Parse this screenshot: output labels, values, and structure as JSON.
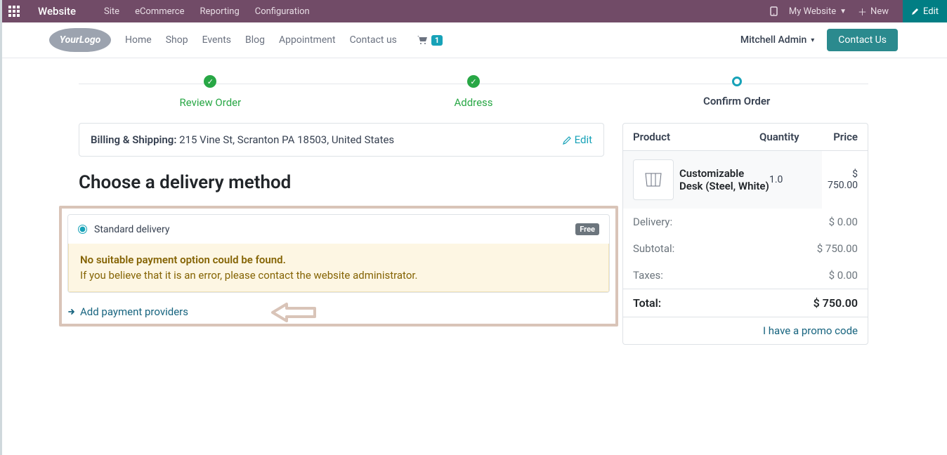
{
  "topbar": {
    "title": "Website",
    "menu": [
      "Site",
      "eCommerce",
      "Reporting",
      "Configuration"
    ],
    "website_selector": "My Website",
    "new_btn": "New",
    "edit_btn": "Edit"
  },
  "header": {
    "logo_text": "YourLogo",
    "nav": [
      "Home",
      "Shop",
      "Events",
      "Blog",
      "Appointment",
      "Contact us"
    ],
    "cart_count": "1",
    "user_name": "Mitchell Admin",
    "contact_btn": "Contact Us"
  },
  "stepper": {
    "steps": [
      {
        "label": "Review Order",
        "state": "done"
      },
      {
        "label": "Address",
        "state": "done"
      },
      {
        "label": "Confirm Order",
        "state": "current"
      }
    ]
  },
  "billing": {
    "label": "Billing & Shipping:",
    "address": "215 Vine St, Scranton PA 18503, United States",
    "edit_label": "Edit"
  },
  "delivery": {
    "heading": "Choose a delivery method",
    "option_label": "Standard delivery",
    "free_badge": "Free",
    "warning_title": "No suitable payment option could be found.",
    "warning_text": "If you believe that it is an error, please contact the website administrator.",
    "add_providers": "Add payment providers"
  },
  "summary": {
    "cols": {
      "product": "Product",
      "qty": "Quantity",
      "price": "Price"
    },
    "item": {
      "name": "Customizable Desk (Steel, White)",
      "qty": "1.0",
      "price": "$ 750.00"
    },
    "rows": [
      {
        "label": "Delivery:",
        "value": "$ 0.00"
      },
      {
        "label": "Subtotal:",
        "value": "$ 750.00"
      },
      {
        "label": "Taxes:",
        "value": "$ 0.00"
      }
    ],
    "total_label": "Total:",
    "total_value": "$ 750.00",
    "promo_link": "I have a promo code"
  }
}
